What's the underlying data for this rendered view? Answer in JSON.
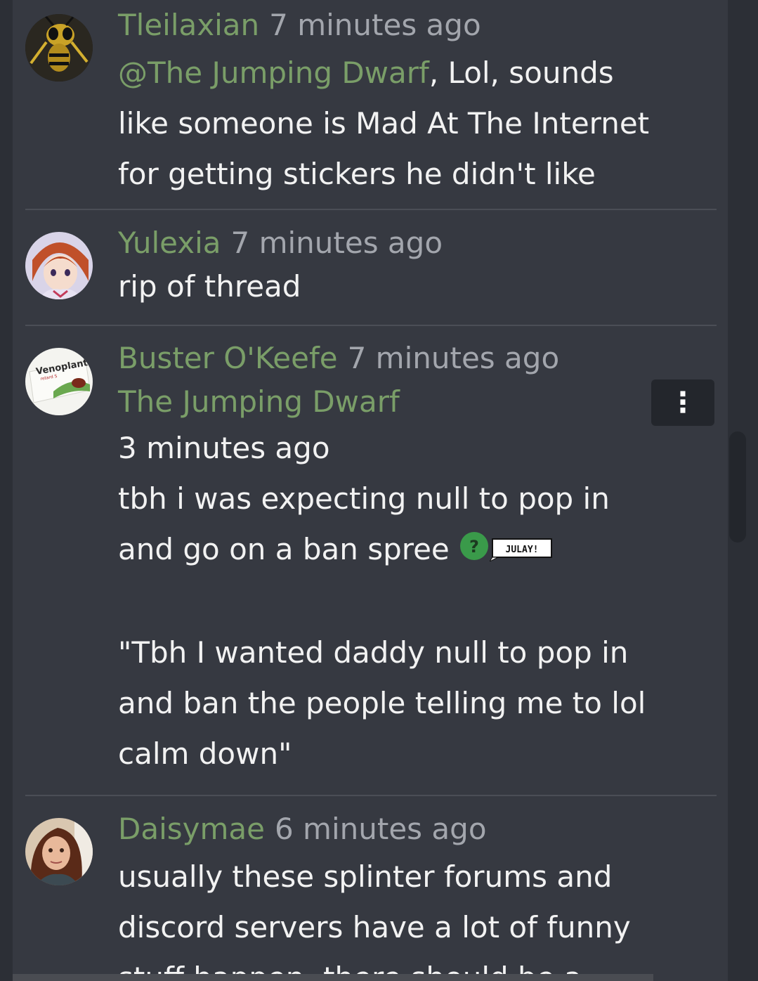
{
  "comments": [
    {
      "username": "Tleilaxian",
      "time": "7 minutes ago",
      "mention": "@The Jumping Dwarf",
      "lines": [
        ", Lol, sounds",
        "like someone is Mad At The Internet",
        "for getting stickers he didn't like"
      ]
    },
    {
      "username": "Yulexia",
      "time": "7 minutes ago",
      "lines": [
        "rip of thread"
      ]
    },
    {
      "username": "Buster O'Keefe",
      "time": "7 minutes ago",
      "quote_author": "The Jumping Dwarf",
      "quote_time": "3 minutes ago",
      "lines": [
        "tbh i was expecting null to pop in",
        "and go on a ban spree",
        "\"Tbh I wanted daddy null to pop in",
        "and ban the people telling me to lol",
        "calm down\""
      ],
      "sticker_text": "JULAY!",
      "sticker_icon": "?",
      "avatar_label": "Venoplant",
      "avatar_sublabel": "retard S",
      "menu_icon": "⋮"
    },
    {
      "username": "Daisymae",
      "time": "6 minutes ago",
      "lines": [
        "usually these splinter forums and",
        "discord servers have a lot of funny",
        "stuff happen, there should be a"
      ]
    }
  ],
  "colors": {
    "username": "#7a9e68",
    "text": "#f2f2f2",
    "meta": "#a3a6ad",
    "panel": "#363941"
  }
}
